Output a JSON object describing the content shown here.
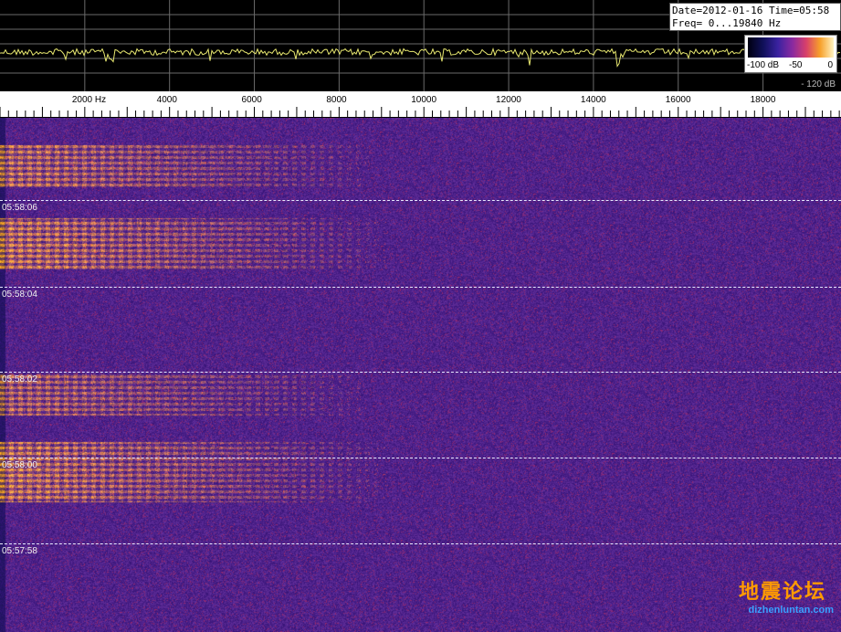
{
  "info": {
    "date_time": "Date=2012-01-16 Time=05:58",
    "freq_range": "Freq= 0...19840 Hz"
  },
  "legend": {
    "min_label": "-100 dB",
    "mid_label": "-50",
    "max_label": "0"
  },
  "floor_label": "- 120 dB",
  "freq_axis": {
    "max_hz": 19840,
    "tick_labels": [
      {
        "hz": 2000,
        "text": "2000  Hz"
      },
      {
        "hz": 4000,
        "text": "4000"
      },
      {
        "hz": 6000,
        "text": "6000"
      },
      {
        "hz": 8000,
        "text": "8000"
      },
      {
        "hz": 10000,
        "text": "10000"
      },
      {
        "hz": 12000,
        "text": "12000"
      },
      {
        "hz": 14000,
        "text": "14000"
      },
      {
        "hz": 16000,
        "text": "16000"
      },
      {
        "hz": 18000,
        "text": "18000"
      }
    ]
  },
  "waterfall": {
    "time_markers": [
      "05:58:06",
      "05:58:04",
      "05:58:02",
      "05:58:00",
      "05:57:58"
    ]
  },
  "watermark": {
    "text": "地震论坛",
    "url": "dizhenluntan.com"
  },
  "colors": {
    "trace": "#e8e870",
    "grid": "#6a6a6a",
    "background": "#3a2480",
    "signal": "#f7b02a"
  }
}
